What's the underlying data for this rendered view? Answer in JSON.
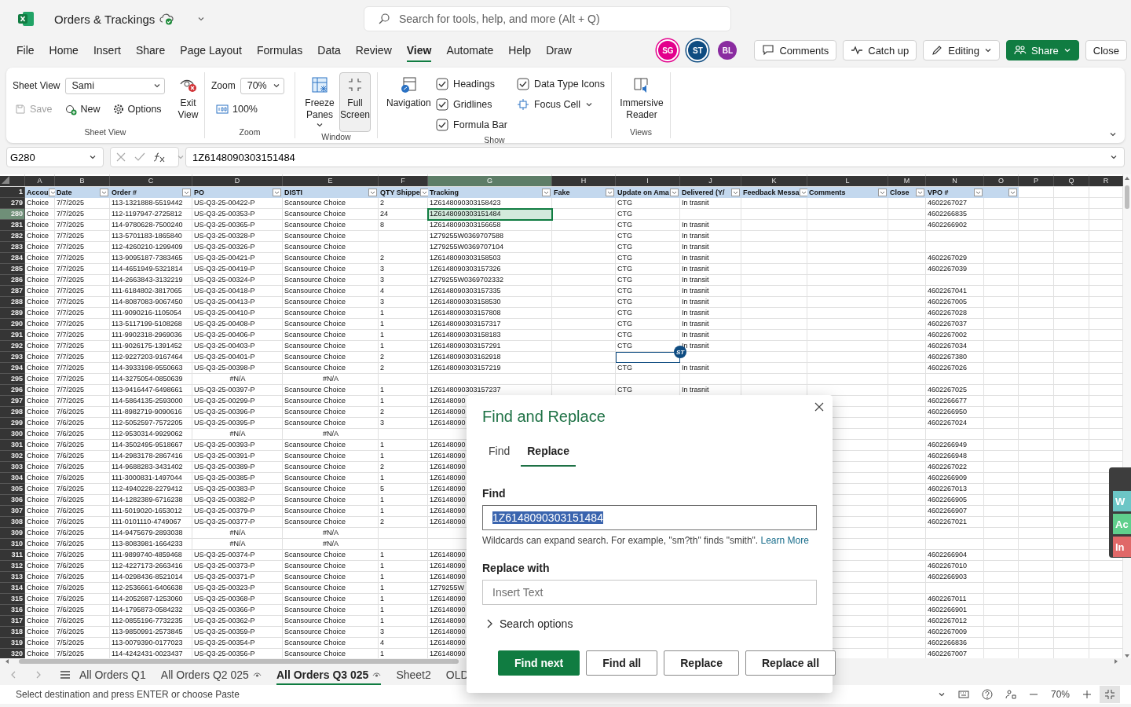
{
  "app": {
    "title": "Orders & Trackings",
    "search_placeholder": "Search for tools, help, and more (Alt + Q)"
  },
  "menu_tabs": [
    {
      "label": "File",
      "selected": false
    },
    {
      "label": "Home",
      "selected": false
    },
    {
      "label": "Insert",
      "selected": false
    },
    {
      "label": "Share",
      "selected": false
    },
    {
      "label": "Page Layout",
      "selected": false
    },
    {
      "label": "Formulas",
      "selected": false
    },
    {
      "label": "Data",
      "selected": false
    },
    {
      "label": "Review",
      "selected": false
    },
    {
      "label": "View",
      "selected": true
    },
    {
      "label": "Automate",
      "selected": false
    },
    {
      "label": "Help",
      "selected": false
    },
    {
      "label": "Draw",
      "selected": false
    }
  ],
  "collaborators": [
    {
      "initials": "SG",
      "color": "#e3008c",
      "active": true
    },
    {
      "initials": "ST",
      "color": "#0f4c81",
      "active": true
    },
    {
      "initials": "BL",
      "color": "#8a2ca0",
      "active": false
    }
  ],
  "header_buttons": [
    {
      "label": "Comments",
      "kind": "comments"
    },
    {
      "label": "Catch up",
      "kind": "catchup"
    },
    {
      "label": "Editing",
      "kind": "editing"
    },
    {
      "label": "Share",
      "kind": "share"
    },
    {
      "label": "Close",
      "kind": "close"
    }
  ],
  "ribbon": {
    "sheet_view": {
      "group": "Sheet View",
      "label": "Sheet View",
      "view": "Sami",
      "save": {
        "label": "Save",
        "disabled": true
      },
      "new": "New",
      "options": "Options",
      "exit": "Exit View"
    },
    "zoom": {
      "group": "Zoom",
      "label": "Zoom",
      "value": "70%",
      "reset": "100%"
    },
    "window": {
      "group": "Window",
      "freeze": "Freeze Panes",
      "full_screen": {
        "label": "Full Screen",
        "pressed": true
      }
    },
    "show": {
      "group": "Show",
      "navigation": "Navigation",
      "checks": [
        {
          "label": "Headings",
          "checked": true
        },
        {
          "label": "Gridlines",
          "checked": true
        },
        {
          "label": "Formula Bar",
          "checked": true
        },
        {
          "label": "Data Type Icons",
          "checked": true
        }
      ],
      "focus_cell": "Focus Cell"
    },
    "views": {
      "group": "Views",
      "immersive": "Immersive Reader"
    }
  },
  "formula_bar": {
    "name_box": "G280",
    "value": "1Z6148090303151484"
  },
  "sheet": {
    "header_row_number": "1",
    "columns": [
      {
        "letter": "A",
        "header": "Accou",
        "filter": true,
        "selected": false
      },
      {
        "letter": "B",
        "header": "Date",
        "filter": true,
        "selected": false
      },
      {
        "letter": "C",
        "header": "Order #",
        "filter": true,
        "selected": false
      },
      {
        "letter": "D",
        "header": "PO",
        "filter": true,
        "selected": false
      },
      {
        "letter": "E",
        "header": "DISTI",
        "filter": true,
        "selected": false
      },
      {
        "letter": "F",
        "header": "QTY Shippe",
        "filter": true,
        "selected": false
      },
      {
        "letter": "G",
        "header": "Tracking",
        "filter": true,
        "selected": true
      },
      {
        "letter": "H",
        "header": "Fake",
        "filter": true,
        "selected": false
      },
      {
        "letter": "I",
        "header": "Update on Ama",
        "filter": true,
        "selected": false
      },
      {
        "letter": "J",
        "header": "Delivered (Y/",
        "filter": true,
        "selected": false
      },
      {
        "letter": "K",
        "header": "Feedback Messa",
        "filter": true,
        "selected": false
      },
      {
        "letter": "L",
        "header": "Comments",
        "filter": true,
        "selected": false
      },
      {
        "letter": "M",
        "header": "Close",
        "filter": true,
        "selected": false
      },
      {
        "letter": "N",
        "header": "VPO #",
        "filter": true,
        "selected": false
      },
      {
        "letter": "O",
        "filter": true,
        "selected": false
      },
      {
        "letter": "P",
        "filter": false,
        "selected": false
      },
      {
        "letter": "Q",
        "filter": false,
        "selected": false
      },
      {
        "letter": "R",
        "filter": false,
        "selected": false
      }
    ],
    "rows": [
      {
        "number": "279",
        "selected": false,
        "cells": [
          "Choice",
          "7/7/2025",
          "113-1321888-5519442",
          "US-Q3-25-00422-P",
          "Scansource Choice",
          "2",
          "1Z6148090303158423",
          null,
          "CTG",
          "In trasnit",
          null,
          null,
          null,
          "4602267027"
        ]
      },
      {
        "number": "280",
        "selected": true,
        "cells": [
          "Choice",
          "7/7/2025",
          "112-1197947-2725812",
          "US-Q3-25-00353-P",
          "Scansource Choice",
          "24",
          "1Z6148090303151484",
          null,
          "CTG",
          null,
          null,
          null,
          null,
          "4602266835"
        ]
      },
      {
        "number": "281",
        "selected": false,
        "cells": [
          "Choice",
          "7/7/2025",
          "114-9780628-7500240",
          "US-Q3-25-00365-P",
          "Scansource Choice",
          "8",
          "1Z6148090303156658",
          null,
          "CTG",
          "In trasnit",
          null,
          null,
          null,
          "4602266902"
        ]
      },
      {
        "number": "282",
        "selected": false,
        "cells": [
          "Choice",
          "7/7/2025",
          "113-5701183-1865840",
          "US-Q3-25-00328-P",
          "Scansource Choice",
          null,
          "1Z79255W0369707588",
          null,
          "CTG",
          "In transit",
          null,
          null,
          null,
          null
        ]
      },
      {
        "number": "283",
        "selected": false,
        "cells": [
          "Choice",
          "7/7/2025",
          "112-4260210-1299409",
          "US-Q3-25-00326-P",
          "Scansource Choice",
          null,
          "1Z79255W0369707104",
          null,
          "CTG",
          "In transit",
          null,
          null,
          null,
          null
        ]
      },
      {
        "number": "284",
        "selected": false,
        "cells": [
          "Choice",
          "7/7/2025",
          "113-9095187-7383465",
          "US-Q3-25-00421-P",
          "Scansource Choice",
          "2",
          "1Z6148090303158503",
          null,
          "CTG",
          "In trasnit",
          null,
          null,
          null,
          "4602267029"
        ]
      },
      {
        "number": "285",
        "selected": false,
        "cells": [
          "Choice",
          "7/7/2025",
          "114-4651949-5321814",
          "US-Q3-25-00419-P",
          "Scansource Choice",
          "3",
          "1Z6148090303157326",
          null,
          "CTG",
          "In trasnit",
          null,
          null,
          null,
          "4602267039"
        ]
      },
      {
        "number": "286",
        "selected": false,
        "cells": [
          "Choice",
          "7/7/2025",
          "114-2663843-3132219",
          "US-Q3-25-00324-P",
          "Scansource Choice",
          "3",
          "1Z79255W0369702332",
          null,
          "CTG",
          "In transit",
          null,
          null,
          null,
          null
        ]
      },
      {
        "number": "287",
        "selected": false,
        "cells": [
          "Choice",
          "7/7/2025",
          "111-6184802-3817065",
          "US-Q3-25-00418-P",
          "Scansource Choice",
          "4",
          "1Z6148090303157335",
          null,
          "CTG",
          "In trasnit",
          null,
          null,
          null,
          "4602267041"
        ]
      },
      {
        "number": "288",
        "selected": false,
        "cells": [
          "Choice",
          "7/7/2025",
          "114-8087083-9067450",
          "US-Q3-25-00413-P",
          "Scansource Choice",
          "3",
          "1Z6148090303158530",
          null,
          "CTG",
          "In trasnit",
          null,
          null,
          null,
          "4602267005"
        ]
      },
      {
        "number": "289",
        "selected": false,
        "cells": [
          "Choice",
          "7/7/2025",
          "111-9090216-1105054",
          "US-Q3-25-00410-P",
          "Scansource Choice",
          "1",
          "1Z6148090303157808",
          null,
          "CTG",
          "In trasnit",
          null,
          null,
          null,
          "4602267028"
        ]
      },
      {
        "number": "290",
        "selected": false,
        "cells": [
          "Choice",
          "7/7/2025",
          "113-5117199-5108268",
          "US-Q3-25-00408-P",
          "Scansource Choice",
          "1",
          "1Z6148090303157317",
          null,
          "CTG",
          "In trasnit",
          null,
          null,
          null,
          "4602267037"
        ]
      },
      {
        "number": "291",
        "selected": false,
        "cells": [
          "Choice",
          "7/7/2025",
          "111-9902318-2969036",
          "US-Q3-25-00406-P",
          "Scansource Choice",
          "1",
          "1Z6148090303158183",
          null,
          "CTG",
          "In trasnit",
          null,
          null,
          null,
          "4602267002"
        ]
      },
      {
        "number": "292",
        "selected": false,
        "cells": [
          "Choice",
          "7/7/2025",
          "111-9026175-1391452",
          "US-Q3-25-00403-P",
          "Scansource Choice",
          "1",
          "1Z6148090303157291",
          null,
          "CTG",
          "In trasnit",
          null,
          null,
          null,
          "4602267034"
        ]
      },
      {
        "number": "293",
        "selected": false,
        "cells": [
          "Choice",
          "7/7/2025",
          "112-9227203-9167464",
          "US-Q3-25-00401-P",
          "Scansource Choice",
          "2",
          "1Z6148090303162918",
          null,
          {
            "kind": "collaborator",
            "initials": "ST",
            "color": "#0f4c81"
          },
          null,
          null,
          null,
          null,
          "4602267380"
        ]
      },
      {
        "number": "294",
        "selected": false,
        "cells": [
          "Choice",
          "7/7/2025",
          "114-3933198-9550663",
          "US-Q3-25-00398-P",
          "Scansource Choice",
          "2",
          "1Z6148090303157219",
          null,
          "CTG",
          "In trasnit",
          null,
          null,
          null,
          "4602267026"
        ]
      },
      {
        "number": "295",
        "selected": false,
        "cells": [
          "Choice",
          "7/7/2025",
          "114-3275054-0850639",
          {
            "kind": "error",
            "text": "#N/A"
          },
          {
            "kind": "error",
            "text": "#N/A"
          }
        ]
      },
      {
        "number": "296",
        "selected": false,
        "cells": [
          "Choice",
          "7/7/2025",
          "113-9416447-6498661",
          "US-Q3-25-00397-P",
          "Scansource Choice",
          "1",
          "1Z6148090303157237",
          null,
          "CTG",
          "In trasnit",
          null,
          null,
          null,
          "4602267025"
        ]
      },
      {
        "number": "297",
        "selected": false,
        "cells": [
          "Choice",
          "7/7/2025",
          "114-5864135-2593000",
          "US-Q3-25-00299-P",
          "Scansource Choice",
          "1",
          "1Z6148090",
          null,
          null,
          null,
          null,
          null,
          null,
          "4602266677"
        ]
      },
      {
        "number": "298",
        "selected": false,
        "cells": [
          "Choice",
          "7/6/2025",
          "111-8982719-9090616",
          "US-Q3-25-00396-P",
          "Scansource Choice",
          "2",
          "1Z6148090",
          null,
          null,
          null,
          null,
          null,
          null,
          "4602266950"
        ]
      },
      {
        "number": "299",
        "selected": false,
        "cells": [
          "Choice",
          "7/6/2025",
          "112-5052597-7572205",
          "US-Q3-25-00395-P",
          "Scansource Choice",
          "3",
          "1Z6148090",
          null,
          null,
          null,
          null,
          null,
          null,
          "4602267024"
        ]
      },
      {
        "number": "300",
        "selected": false,
        "cells": [
          "Choice",
          "7/6/2025",
          "112-9530314-9929062",
          {
            "kind": "error",
            "text": "#N/A"
          },
          {
            "kind": "error",
            "text": "#N/A"
          }
        ]
      },
      {
        "number": "301",
        "selected": false,
        "cells": [
          "Choice",
          "7/6/2025",
          "114-3502495-9518667",
          "US-Q3-25-00393-P",
          "Scansource Choice",
          "1",
          "1Z6148090",
          null,
          null,
          null,
          null,
          null,
          null,
          "4602266949"
        ]
      },
      {
        "number": "302",
        "selected": false,
        "cells": [
          "Choice",
          "7/6/2025",
          "114-2983178-2867416",
          "US-Q3-25-00391-P",
          "Scansource Choice",
          "1",
          "1Z6148090",
          null,
          null,
          null,
          null,
          null,
          null,
          "4602266948"
        ]
      },
      {
        "number": "303",
        "selected": false,
        "cells": [
          "Choice",
          "7/6/2025",
          "114-9688283-3431402",
          "US-Q3-25-00389-P",
          "Scansource Choice",
          "2",
          "1Z6148090",
          null,
          null,
          null,
          null,
          null,
          null,
          "4602267022"
        ]
      },
      {
        "number": "304",
        "selected": false,
        "cells": [
          "Choice",
          "7/6/2025",
          "111-3000831-1497044",
          "US-Q3-25-00385-P",
          "Scansource Choice",
          "1",
          "1Z6148090",
          null,
          null,
          null,
          null,
          null,
          null,
          "4602266909"
        ]
      },
      {
        "number": "305",
        "selected": false,
        "cells": [
          "Choice",
          "7/6/2025",
          "112-4940228-2279412",
          "US-Q3-25-00383-P",
          "Scansource Choice",
          "5",
          "1Z6148090",
          null,
          null,
          null,
          null,
          null,
          null,
          "4602267013"
        ]
      },
      {
        "number": "306",
        "selected": false,
        "cells": [
          "Choice",
          "7/6/2025",
          "114-1282389-6716238",
          "US-Q3-25-00382-P",
          "Scansource Choice",
          "1",
          "1Z6148090",
          null,
          null,
          null,
          null,
          null,
          null,
          "4602266905"
        ]
      },
      {
        "number": "307",
        "selected": false,
        "cells": [
          "Choice",
          "7/6/2025",
          "111-5019020-1653012",
          "US-Q3-25-00379-P",
          "Scansource Choice",
          "1",
          "1Z6148090",
          null,
          null,
          null,
          null,
          null,
          null,
          "4602266907"
        ]
      },
      {
        "number": "308",
        "selected": false,
        "cells": [
          "Choice",
          "7/6/2025",
          "111-0101110-4749067",
          "US-Q3-25-00377-P",
          "Scansource Choice",
          "2",
          "1Z6148090",
          null,
          null,
          null,
          null,
          null,
          null,
          "4602267021"
        ]
      },
      {
        "number": "309",
        "selected": false,
        "cells": [
          "Choice",
          "7/6/2025",
          "114-9475679-2893038",
          {
            "kind": "error",
            "text": "#N/A"
          },
          {
            "kind": "error",
            "text": "#N/A"
          }
        ]
      },
      {
        "number": "310",
        "selected": false,
        "cells": [
          "Choice",
          "7/6/2025",
          "113-8083981-1664233",
          {
            "kind": "error",
            "text": "#N/A"
          },
          {
            "kind": "error",
            "text": "#N/A"
          }
        ]
      },
      {
        "number": "311",
        "selected": false,
        "cells": [
          "Choice",
          "7/6/2025",
          "111-9899740-4859468",
          "US-Q3-25-00374-P",
          "Scansource Choice",
          "1",
          "1Z6148090",
          null,
          null,
          null,
          null,
          null,
          null,
          "4602266904"
        ]
      },
      {
        "number": "312",
        "selected": false,
        "cells": [
          "Choice",
          "7/6/2025",
          "112-4227173-2663416",
          "US-Q3-25-00373-P",
          "Scansource Choice",
          "1",
          "1Z6148090",
          null,
          null,
          null,
          null,
          null,
          null,
          "4602267010"
        ]
      },
      {
        "number": "313",
        "selected": false,
        "cells": [
          "Choice",
          "7/6/2025",
          "114-0298436-8521014",
          "US-Q3-25-00371-P",
          "Scansource Choice",
          "1",
          "1Z6148090",
          null,
          null,
          null,
          null,
          null,
          null,
          "4602266903"
        ]
      },
      {
        "number": "314",
        "selected": false,
        "cells": [
          "Choice",
          "7/6/2025",
          "112-2536661-6406638",
          "US-Q3-25-00323-P",
          "Scansource Choice",
          "1",
          "1Z79255W"
        ]
      },
      {
        "number": "315",
        "selected": false,
        "cells": [
          "Choice",
          "7/6/2025",
          "114-2052687-1253060",
          "US-Q3-25-00368-P",
          "Scansource Choice",
          "1",
          "1Z6148090",
          null,
          null,
          null,
          null,
          null,
          null,
          "4602267011"
        ]
      },
      {
        "number": "316",
        "selected": false,
        "cells": [
          "Choice",
          "7/6/2025",
          "114-1795873-0584232",
          "US-Q3-25-00366-P",
          "Scansource Choice",
          "1",
          "1Z6148090",
          null,
          null,
          null,
          null,
          null,
          null,
          "4602266901"
        ]
      },
      {
        "number": "317",
        "selected": false,
        "cells": [
          "Choice",
          "7/6/2025",
          "112-0855196-7732235",
          "US-Q3-25-00362-P",
          "Scansource Choice",
          "1",
          "1Z6148090",
          null,
          null,
          null,
          null,
          null,
          null,
          "4602267012"
        ]
      },
      {
        "number": "318",
        "selected": false,
        "cells": [
          "Choice",
          "7/6/2025",
          "113-9850991-2573845",
          "US-Q3-25-00359-P",
          "Scansource Choice",
          "3",
          "1Z6148090",
          null,
          null,
          null,
          null,
          null,
          null,
          "4602267009"
        ]
      },
      {
        "number": "319",
        "selected": false,
        "cells": [
          "Choice",
          "7/5/2025",
          "113-0079390-0177023",
          "US-Q3-25-00354-P",
          "Scansource Choice",
          "4",
          "1Z6148090",
          null,
          null,
          null,
          null,
          null,
          null,
          "4602266836"
        ]
      },
      {
        "number": "320",
        "selected": false,
        "cells": [
          "Choice",
          "7/5/2025",
          "114-4242431-0023437",
          "US-Q3-25-00356-P",
          "Scansource Choice",
          "1",
          "1Z6148090",
          null,
          null,
          null,
          null,
          null,
          null,
          "4602267007"
        ]
      }
    ]
  },
  "sheet_tabs": [
    {
      "label": "All Orders Q1",
      "selected": false,
      "shared_view": false
    },
    {
      "label": "All Orders Q2 025",
      "selected": false,
      "shared_view": true
    },
    {
      "label": "All Orders Q3 025",
      "selected": true,
      "shared_view": true
    },
    {
      "label": "Sheet2",
      "selected": false,
      "shared_view": false
    },
    {
      "label": "OLD",
      "selected": false,
      "shared_view": false
    }
  ],
  "status_bar": {
    "message": "Select destination and press ENTER or choose Paste",
    "zoom": "70%"
  },
  "side_tabs": [
    {
      "label": "W",
      "color": "#6cc6c6"
    },
    {
      "label": "Ac",
      "color": "#5fcf8c"
    },
    {
      "label": "In",
      "color": "#e06868"
    }
  ],
  "dialog": {
    "title": "Find and Replace",
    "tabs": [
      {
        "label": "Find",
        "selected": false
      },
      {
        "label": "Replace",
        "selected": true
      }
    ],
    "find_label": "Find",
    "find_value": {
      "text": "1Z6148090303151484",
      "selected": true
    },
    "hint": "Wildcards can expand search. For example, \"sm?th\" finds \"smith\".",
    "link": "Learn More",
    "replace_label": "Replace with",
    "replace_placeholder": "Insert Text",
    "options": {
      "label": "Search options",
      "expanded": false
    },
    "buttons": [
      {
        "label": "Find next",
        "primary": true
      },
      {
        "label": "Find all",
        "primary": false
      },
      {
        "label": "Replace",
        "primary": false
      },
      {
        "label": "Replace all",
        "primary": false
      }
    ]
  }
}
